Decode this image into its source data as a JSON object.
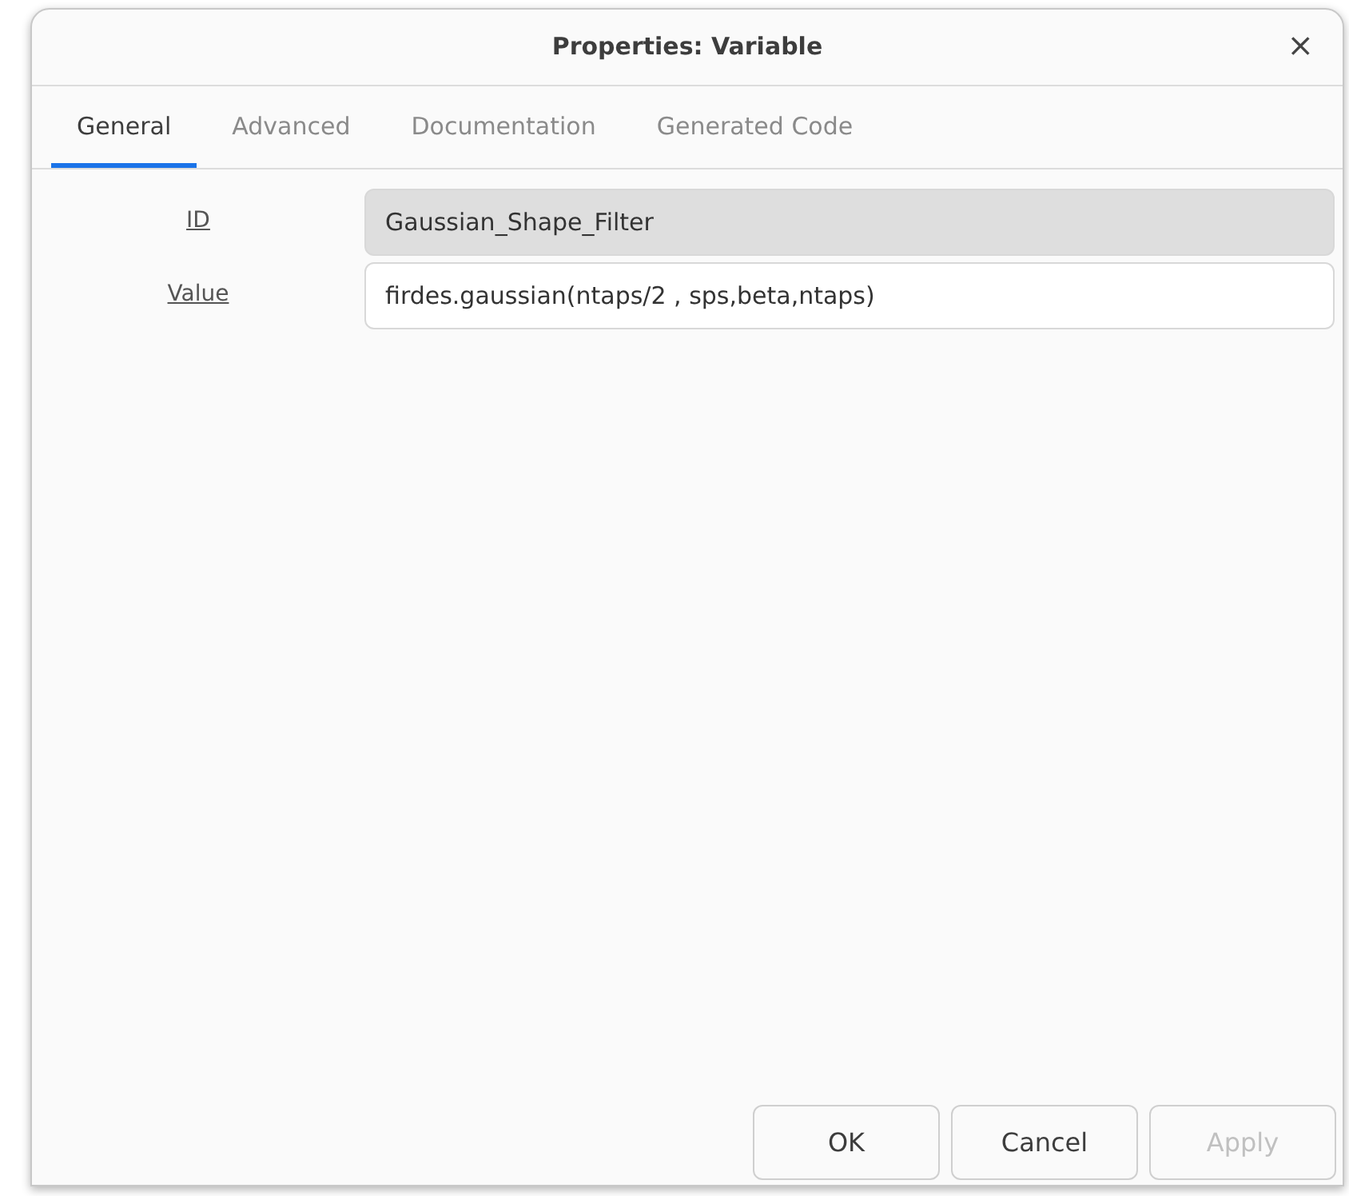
{
  "window": {
    "title": "Properties: Variable",
    "close": "×"
  },
  "tabs": [
    {
      "label": "General",
      "selected": true
    },
    {
      "label": "Advanced",
      "selected": false
    },
    {
      "label": "Documentation",
      "selected": false
    },
    {
      "label": "Generated Code",
      "selected": false
    }
  ],
  "fields": [
    {
      "label": "ID",
      "value": "Gaussian_Shape_Filter",
      "disabled": true
    },
    {
      "label": "Value",
      "value": "firdes.gaussian(ntaps/2 , sps,beta,ntaps)",
      "disabled": false
    }
  ],
  "buttons": [
    {
      "label": "OK",
      "disabled": false
    },
    {
      "label": "Cancel",
      "disabled": false
    },
    {
      "label": "Apply",
      "disabled": true
    }
  ]
}
